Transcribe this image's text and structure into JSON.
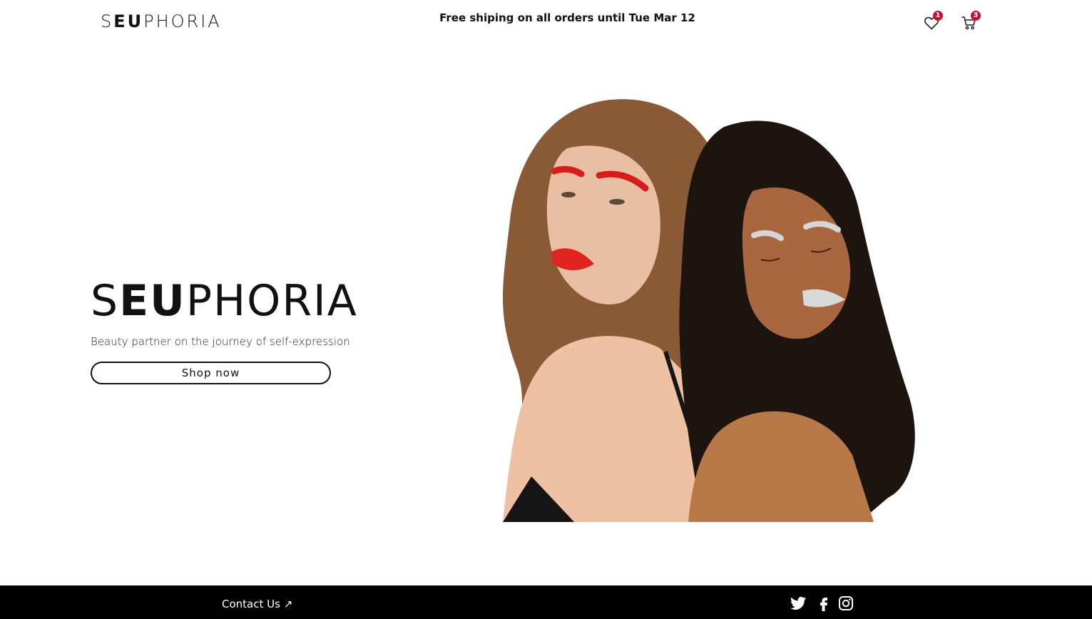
{
  "header": {
    "logo_prefix": "S",
    "logo_bold": "EU",
    "logo_suffix": "PHORIA",
    "promo_text": "Free shiping on all orders until Tue Mar 12",
    "wishlist_count": "1",
    "cart_count": "3",
    "icons": [
      "heart-icon",
      "cart-icon"
    ]
  },
  "hero": {
    "title_prefix": "S",
    "title_bold": "EU",
    "title_suffix": "PHORIA",
    "subtitle": "Beauty partner on the journey of self-expression",
    "cta_label": "Shop now",
    "image_alt": "Two models with bold makeup"
  },
  "footer": {
    "contact_label": "Contact Us ↗",
    "social": [
      "twitter-icon",
      "facebook-icon",
      "instagram-icon"
    ]
  },
  "colors": {
    "badge": "#c8102e",
    "footer_bg": "#000000",
    "text": "#111111"
  }
}
